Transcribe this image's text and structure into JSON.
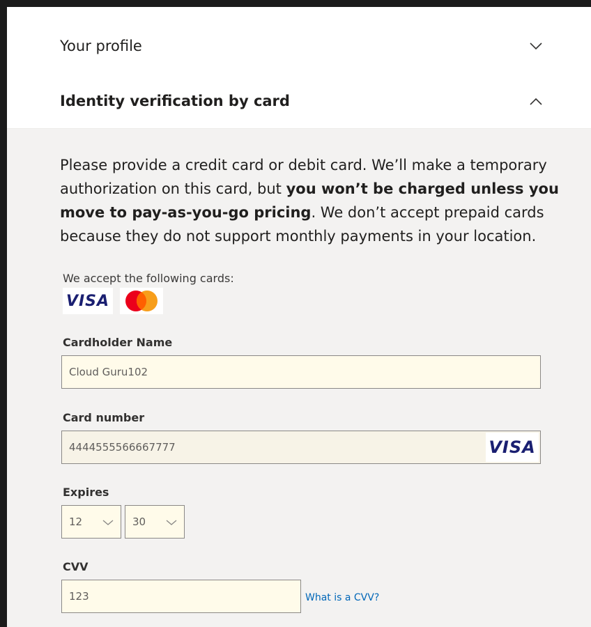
{
  "accordion": {
    "profile_title": "Your profile",
    "identity_title": "Identity verification by card"
  },
  "intro": {
    "part1": "Please provide a credit card or debit card. We’ll make a temporary authorization on this card, but ",
    "bold": "you won’t be charged unless you move to pay-as-you-go pricing",
    "part2": ". We don’t accept prepaid cards because they do not support monthly payments in your location."
  },
  "cards": {
    "accept_label": "We accept the following cards:",
    "visa": "VISA"
  },
  "form": {
    "cardholder_label": "Cardholder Name",
    "cardholder_value": "Cloud Guru102",
    "cardnumber_label": "Card number",
    "cardnumber_value": "4444555566667777",
    "cardnumber_brand": "VISA",
    "expires_label": "Expires",
    "expires_month": "12",
    "expires_year": "30",
    "cvv_label": "CVV",
    "cvv_value": "123",
    "cvv_link": "What is a CVV?"
  },
  "colors": {
    "visa_blue": "#1a1f71",
    "mastercard_red": "#eb001b",
    "mastercard_orange": "#f79e1b",
    "link_blue": "#0067b8",
    "autofill_yellow": "#fffbea"
  },
  "icons": {
    "profile_chevron": "chevron-down-icon",
    "identity_chevron": "chevron-up-icon",
    "select_chevron": "chevron-down-icon"
  }
}
